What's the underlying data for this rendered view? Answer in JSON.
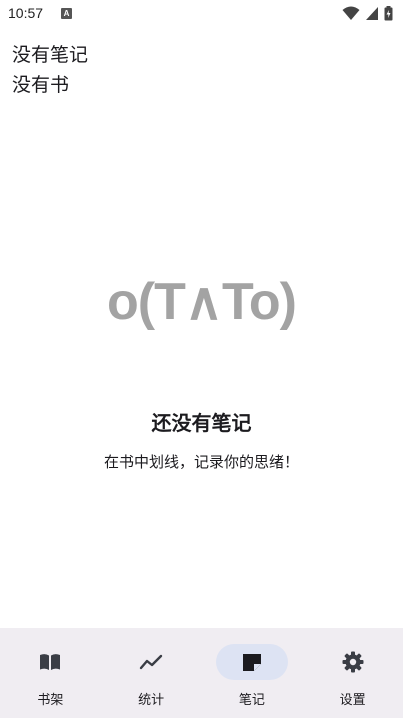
{
  "status_bar": {
    "time": "10:57",
    "notification_icon": "A",
    "icons": [
      "wifi-icon",
      "signal-icon",
      "battery-icon"
    ]
  },
  "header": {
    "line1": "没有笔记",
    "line2": "没有书"
  },
  "empty_state": {
    "emoticon": "o(T∧To)",
    "title": "还没有笔记",
    "subtitle": "在书中划线，记录你的思绪！"
  },
  "bottom_nav": {
    "items": [
      {
        "label": "书架",
        "icon": "book-icon",
        "active": false
      },
      {
        "label": "统计",
        "icon": "trend-icon",
        "active": false
      },
      {
        "label": "笔记",
        "icon": "note-icon",
        "active": true
      },
      {
        "label": "设置",
        "icon": "gear-icon",
        "active": false
      }
    ]
  },
  "colors": {
    "nav_background": "#f0edf2",
    "active_pill": "#dde3f3",
    "emoticon": "#a3a3a3"
  }
}
